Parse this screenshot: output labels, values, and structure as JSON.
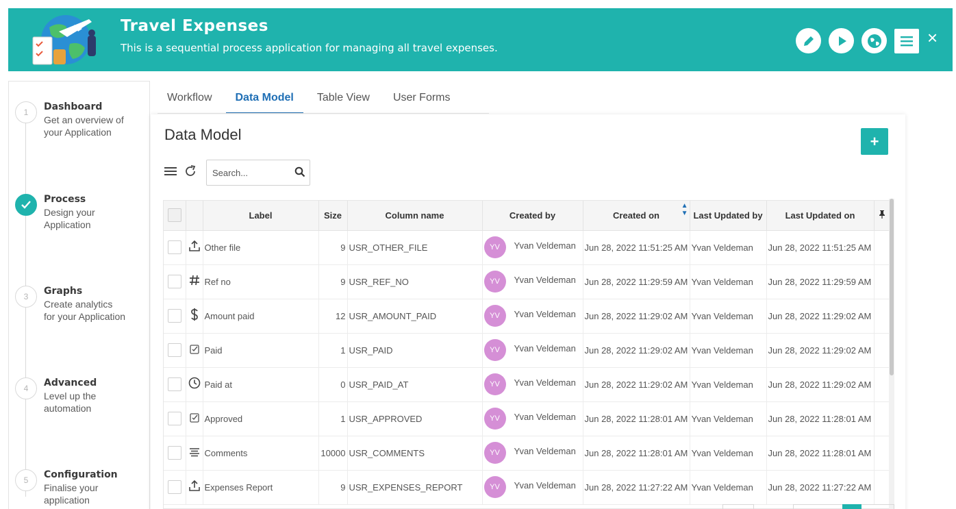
{
  "header": {
    "title": "Travel Expenses",
    "subtitle": "This is a sequential process application for managing all travel expenses.",
    "close": "×",
    "bg_color": "#1fb3ad"
  },
  "steps": [
    {
      "num": "1",
      "title": "Dashboard",
      "desc": "Get an overview of your Application",
      "done": false
    },
    {
      "num": "2",
      "title": "Process",
      "desc": "Design your Application",
      "done": true
    },
    {
      "num": "3",
      "title": "Graphs",
      "desc": "Create analytics for your Application",
      "done": false
    },
    {
      "num": "4",
      "title": "Advanced",
      "desc": "Level up the automation",
      "done": false
    },
    {
      "num": "5",
      "title": "Configuration",
      "desc": "Finalise your application",
      "done": false
    }
  ],
  "tabs": [
    {
      "label": "Workflow",
      "active": false
    },
    {
      "label": "Data Model",
      "active": true
    },
    {
      "label": "Table View",
      "active": false
    },
    {
      "label": "User Forms",
      "active": false
    }
  ],
  "panel": {
    "title": "Data Model",
    "add_label": "+",
    "search_placeholder": "Search..."
  },
  "table": {
    "columns": {
      "label": "Label",
      "size": "Size",
      "column_name": "Column name",
      "created_by": "Created by",
      "created_on": "Created on",
      "updated_by": "Last Updated by",
      "updated_on": "Last Updated on"
    },
    "rows": [
      {
        "icon": "upload-icon",
        "label": "Other file",
        "size": "9",
        "column_name": "USR_OTHER_FILE",
        "initials": "YV",
        "created_by": "Yvan Veldeman",
        "created_on": "Jun 28, 2022 11:51:25 AM",
        "updated_by": "Yvan Veldeman",
        "updated_on": "Jun 28, 2022 11:51:25 AM"
      },
      {
        "icon": "hash-icon",
        "label": "Ref no",
        "size": "9",
        "column_name": "USR_REF_NO",
        "initials": "YV",
        "created_by": "Yvan Veldeman",
        "created_on": "Jun 28, 2022 11:29:59 AM",
        "updated_by": "Yvan Veldeman",
        "updated_on": "Jun 28, 2022 11:29:59 AM"
      },
      {
        "icon": "dollar-icon",
        "label": "Amount paid",
        "size": "12",
        "column_name": "USR_AMOUNT_PAID",
        "initials": "YV",
        "created_by": "Yvan Veldeman",
        "created_on": "Jun 28, 2022 11:29:02 AM",
        "updated_by": "Yvan Veldeman",
        "updated_on": "Jun 28, 2022 11:29:02 AM"
      },
      {
        "icon": "checkbox-icon",
        "label": "Paid",
        "size": "1",
        "column_name": "USR_PAID",
        "initials": "YV",
        "created_by": "Yvan Veldeman",
        "created_on": "Jun 28, 2022 11:29:02 AM",
        "updated_by": "Yvan Veldeman",
        "updated_on": "Jun 28, 2022 11:29:02 AM"
      },
      {
        "icon": "clock-icon",
        "label": "Paid at",
        "size": "0",
        "column_name": "USR_PAID_AT",
        "initials": "YV",
        "created_by": "Yvan Veldeman",
        "created_on": "Jun 28, 2022 11:29:02 AM",
        "updated_by": "Yvan Veldeman",
        "updated_on": "Jun 28, 2022 11:29:02 AM"
      },
      {
        "icon": "checkbox-icon",
        "label": "Approved",
        "size": "1",
        "column_name": "USR_APPROVED",
        "initials": "YV",
        "created_by": "Yvan Veldeman",
        "created_on": "Jun 28, 2022 11:28:01 AM",
        "updated_by": "Yvan Veldeman",
        "updated_on": "Jun 28, 2022 11:28:01 AM"
      },
      {
        "icon": "text-lines-icon",
        "label": "Comments",
        "size": "10000",
        "column_name": "USR_COMMENTS",
        "initials": "YV",
        "created_by": "Yvan Veldeman",
        "created_on": "Jun 28, 2022 11:28:01 AM",
        "updated_by": "Yvan Veldeman",
        "updated_on": "Jun 28, 2022 11:28:01 AM"
      },
      {
        "icon": "upload-icon",
        "label": "Expenses Report",
        "size": "9",
        "column_name": "USR_EXPENSES_REPORT",
        "initials": "YV",
        "created_by": "Yvan Veldeman",
        "created_on": "Jun 28, 2022 11:27:22 AM",
        "updated_by": "Yvan Veldeman",
        "updated_on": "Jun 28, 2022 11:27:22 AM"
      }
    ]
  }
}
